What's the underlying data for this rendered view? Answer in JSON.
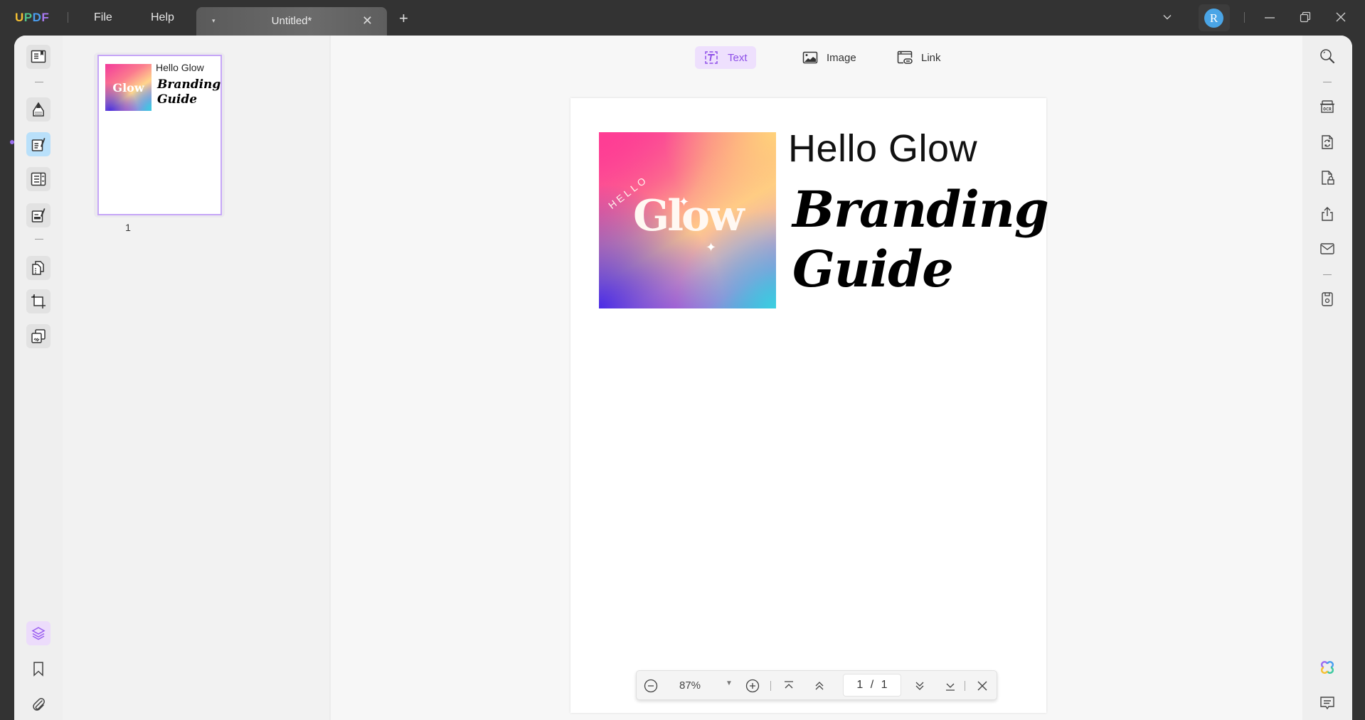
{
  "titlebar": {
    "logo": {
      "u": "U",
      "p": "P",
      "d": "D",
      "f": "F"
    },
    "menus": [
      "File",
      "Help"
    ],
    "tab": {
      "title": "Untitled*",
      "arrow": "▾",
      "close": "✕"
    },
    "new_tab": "+",
    "avatar_initial": "R",
    "window_controls": [
      "chevron-down",
      "minimize",
      "restore",
      "close"
    ]
  },
  "left_sidebar": {
    "top_tools": [
      "reader",
      "comment",
      "edit-pdf",
      "form",
      "fill-sign",
      "organize-pages",
      "crop",
      "watermark"
    ],
    "active_tool": "edit-pdf",
    "bottom_tools": [
      "layers",
      "bookmark",
      "attachment"
    ]
  },
  "thumbnails": {
    "pages": [
      {
        "number": "1",
        "title": "Hello Glow",
        "subtitle_line1": "Branding",
        "subtitle_line2": "Guide",
        "image_text": "Glow"
      }
    ]
  },
  "edit_toolbar": {
    "items": [
      {
        "label": "Text",
        "icon": "text-box-icon",
        "active": true
      },
      {
        "label": "Image",
        "icon": "image-icon",
        "active": false
      },
      {
        "label": "Link",
        "icon": "link-icon",
        "active": false
      }
    ]
  },
  "document": {
    "image": {
      "hello": "HELLO",
      "brand": "Glow"
    },
    "heading": "Hello Glow",
    "title_line1": "Branding",
    "title_line2": "Guide"
  },
  "zoom_bar": {
    "zoom_level": "87%",
    "current_page": "1",
    "separator": "/",
    "total_pages": "1"
  },
  "right_sidebar": {
    "tools": [
      "search",
      "ocr",
      "convert",
      "protect",
      "share",
      "email",
      "save"
    ],
    "bottom_tools": [
      "ai-assistant",
      "comments"
    ]
  },
  "colors": {
    "accent_purple": "#8e4fe8",
    "active_blue": "#b9e0fa",
    "avatar_blue": "#4aa5e6"
  }
}
